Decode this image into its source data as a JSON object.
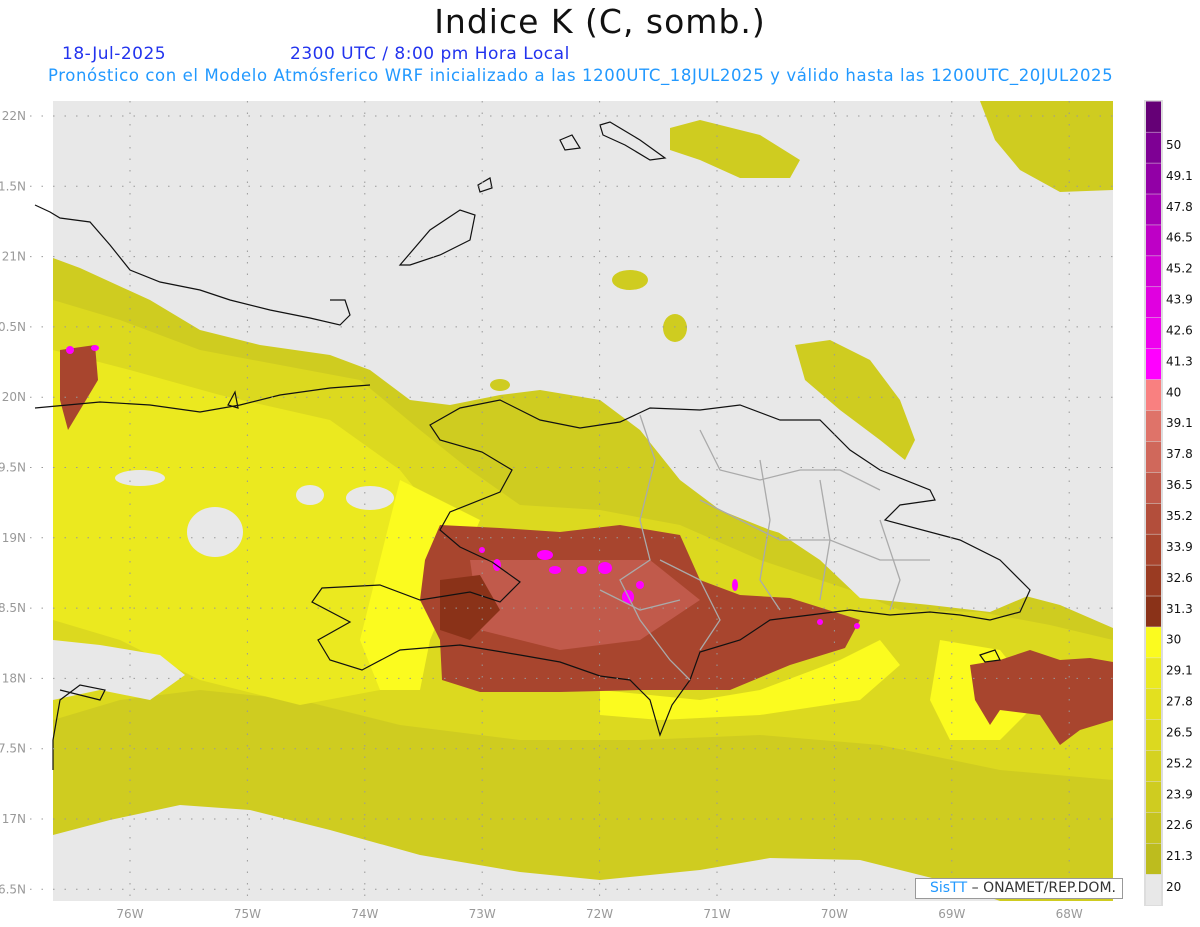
{
  "header": {
    "title": "Indice K (C, somb.)",
    "date": "18-Jul-2025",
    "time": "2300 UTC / 8:00 pm Hora Local",
    "forecast_info": "Pronóstico con el Modelo Atmósferico WRF inicializado a las 1200UTC_18JUL2025 y válido hasta las  1200UTC_20JUL2025"
  },
  "axes": {
    "lon_ticks": [
      {
        "value": -76,
        "label": "76W"
      },
      {
        "value": -75,
        "label": "75W"
      },
      {
        "value": -74,
        "label": "74W"
      },
      {
        "value": -73,
        "label": "73W"
      },
      {
        "value": -72,
        "label": "72W"
      },
      {
        "value": -71,
        "label": "71W"
      },
      {
        "value": -70,
        "label": "70W"
      },
      {
        "value": -69,
        "label": "69W"
      },
      {
        "value": -68,
        "label": "68W"
      }
    ],
    "lat_ticks": [
      {
        "value": 22,
        "label": "22N"
      },
      {
        "value": 21.5,
        "label": "1.5N"
      },
      {
        "value": 21,
        "label": "21N"
      },
      {
        "value": 20.5,
        "label": "0.5N"
      },
      {
        "value": 20,
        "label": "20N"
      },
      {
        "value": 19.5,
        "label": "9.5N"
      },
      {
        "value": 19,
        "label": "19N"
      },
      {
        "value": 18.5,
        "label": "8.5N"
      },
      {
        "value": 18,
        "label": "18N"
      },
      {
        "value": 17.5,
        "label": "7.5N"
      },
      {
        "value": 17,
        "label": "17N"
      },
      {
        "value": 16.5,
        "label": "6.5N"
      }
    ]
  },
  "colorbar": {
    "levels": [
      "20",
      "21.3",
      "22.6",
      "23.9",
      "25.2",
      "26.5",
      "27.8",
      "29.1",
      "30",
      "31.3",
      "32.6",
      "33.9",
      "35.2",
      "36.5",
      "37.8",
      "39.1",
      "40",
      "41.3",
      "42.6",
      "43.9",
      "45.2",
      "46.5",
      "47.8",
      "49.1",
      "50"
    ],
    "colors": [
      "#e8e8e8",
      "#bdbc1e",
      "#c6c41f",
      "#cfcc20",
      "#d5d220",
      "#dcd91f",
      "#e3e01f",
      "#ebe91f",
      "#fbfb1f",
      "#8a3218",
      "#9a3b22",
      "#a8452e",
      "#b34e3b",
      "#c15a4b",
      "#d0685b",
      "#df7369",
      "#f98080",
      "#ff00ff",
      "#ee00ee",
      "#e000e0",
      "#d000d4",
      "#be00c6",
      "#a600b6",
      "#9200a6",
      "#7e0094",
      "#650076"
    ]
  },
  "credit": {
    "brand": "SisΤΤ",
    "text": "– ONAMET/REP.DOM."
  }
}
